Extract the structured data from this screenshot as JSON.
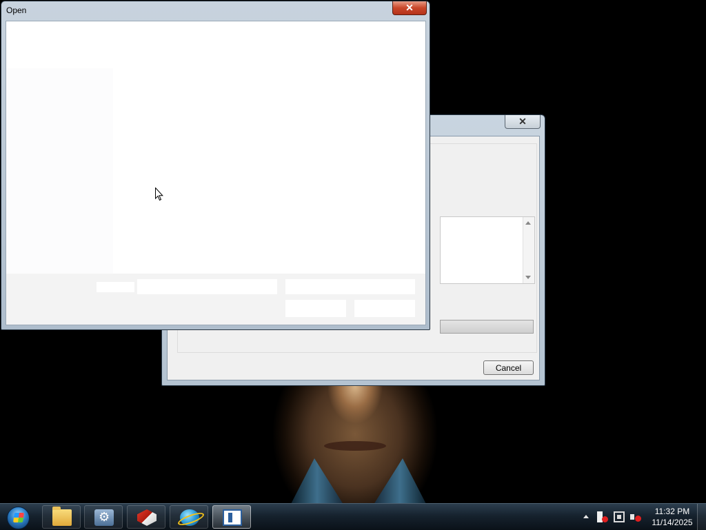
{
  "open_dialog": {
    "title": "Open",
    "close_symbol": "✕"
  },
  "back_dialog": {
    "close_symbol": "✕",
    "cancel_label": "Cancel"
  },
  "taskbar": {
    "buttons": [
      {
        "name": "windows-explorer",
        "icon": "folder-icon"
      },
      {
        "name": "control-panel",
        "icon": "gear-icon"
      },
      {
        "name": "security-app",
        "icon": "shield-icon"
      },
      {
        "name": "browser",
        "icon": "globe-icon"
      },
      {
        "name": "active-window",
        "icon": "window-icon"
      }
    ],
    "clock": {
      "time": "11:32 PM",
      "date": "11/14/2025"
    }
  },
  "colors": {
    "close_red": "#c9472a",
    "taskbar": "#16222e",
    "alert": "#e02020"
  }
}
